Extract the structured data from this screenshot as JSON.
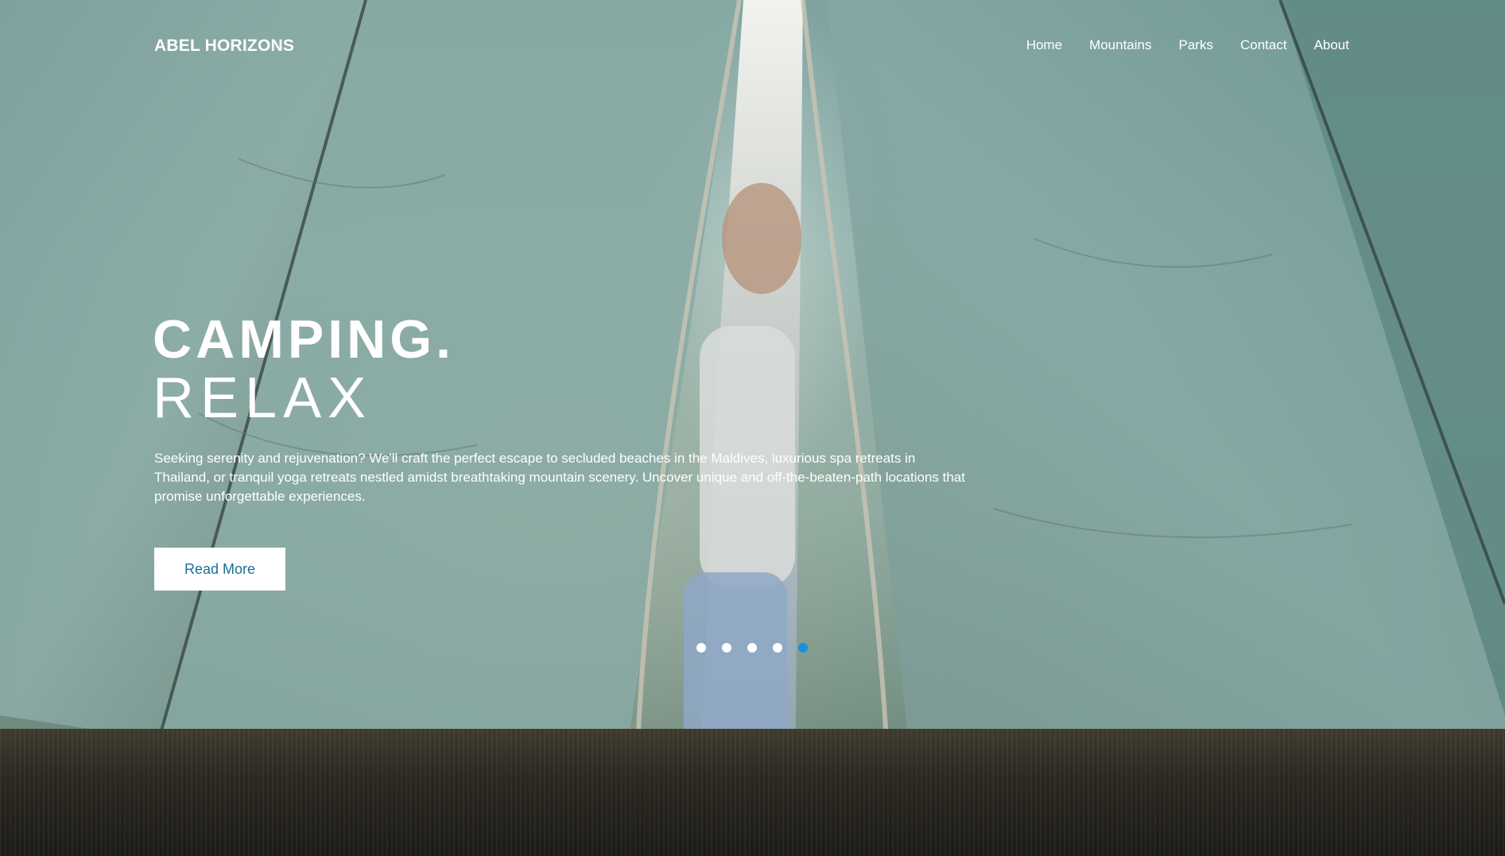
{
  "brand": {
    "name": "ABEL HORIZONS"
  },
  "nav": {
    "items": [
      {
        "label": "Home"
      },
      {
        "label": "Mountains"
      },
      {
        "label": "Parks"
      },
      {
        "label": "Contact"
      },
      {
        "label": "About"
      }
    ]
  },
  "hero": {
    "headline_line1": "CAMPING.",
    "headline_line2": "RELAX",
    "description": "Seeking serenity and rejuvenation? We'll craft the perfect escape to secluded beaches in the Maldives, luxurious spa retreats in Thailand, or tranquil yoga retreats nestled amidst breathtaking mountain scenery. Uncover unique and off-the-beaten-path locations that promise unforgettable experiences.",
    "cta_label": "Read More",
    "background_image": "woman-peeking-through-tent-icon"
  },
  "slider": {
    "total": 5,
    "active_index": 5
  },
  "colors": {
    "accent": "#1a8fe0",
    "button_text": "#1b6e99",
    "text": "#ffffff"
  }
}
